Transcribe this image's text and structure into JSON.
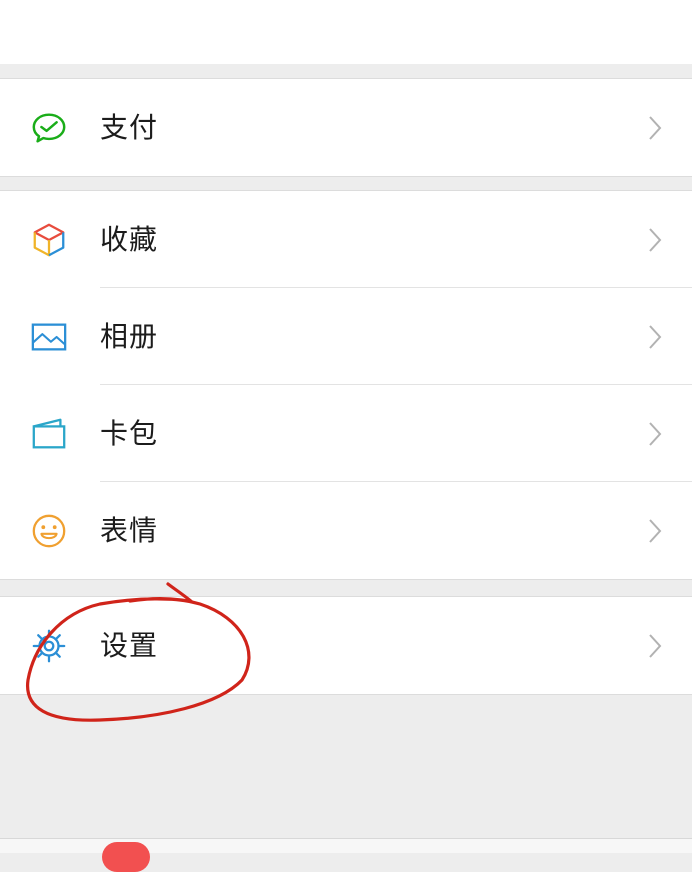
{
  "menu": {
    "pay": {
      "label": "支付",
      "icon": "wechat-pay-icon"
    },
    "favorites": {
      "label": "收藏",
      "icon": "cube-icon"
    },
    "album": {
      "label": "相册",
      "icon": "image-icon"
    },
    "cards": {
      "label": "卡包",
      "icon": "wallet-icon"
    },
    "stickers": {
      "label": "表情",
      "icon": "smiley-icon"
    },
    "settings": {
      "label": "设置",
      "icon": "gear-icon"
    }
  },
  "colors": {
    "pay_green": "#1aad19",
    "accent_blue": "#2b8fd6",
    "emoji_orange": "#f0a030",
    "annotation_red": "#d0241a",
    "badge_red": "#f25050"
  }
}
